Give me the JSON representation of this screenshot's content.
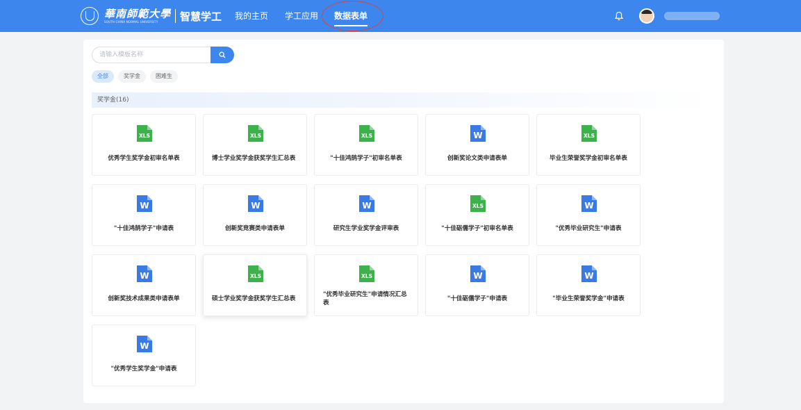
{
  "header": {
    "university_name": "華南師範大學",
    "university_name_en": "SOUTH CHINA NORMAL UNIVERSITY",
    "brand": "智慧学工",
    "nav": [
      {
        "label": "我的主页",
        "active": false
      },
      {
        "label": "学工应用",
        "active": false
      },
      {
        "label": "数据表单",
        "active": true
      }
    ],
    "colors": {
      "bar": "#3d86ee",
      "annotation": "#e04040"
    }
  },
  "search": {
    "placeholder": "请输入模板名称",
    "value": ""
  },
  "filters": [
    {
      "label": "全部",
      "active": true
    },
    {
      "label": "奖学金",
      "active": false
    },
    {
      "label": "困难生",
      "active": false
    }
  ],
  "section": {
    "title": "奖学金(16)"
  },
  "templates": [
    {
      "type": "XLS",
      "title": "优秀学生奖学金初审名单表"
    },
    {
      "type": "XLS",
      "title": "博士学业奖学金获奖学生汇总表"
    },
    {
      "type": "XLS",
      "title": "\"十佳鸿鹄学子\"初审名单表"
    },
    {
      "type": "W",
      "title": "创新奖论文类申请表单"
    },
    {
      "type": "XLS",
      "title": "毕业生荣誉奖学金初审名单表"
    },
    {
      "type": "W",
      "title": "\"十佳鸿鹄学子\"申请表"
    },
    {
      "type": "W",
      "title": "创新奖竞赛类申请表单"
    },
    {
      "type": "W",
      "title": "研究生学业奖学金评审表"
    },
    {
      "type": "XLS",
      "title": "\"十佳砺儒学子\"初审名单表"
    },
    {
      "type": "W",
      "title": "\"优秀毕业研究生\"申请表"
    },
    {
      "type": "W",
      "title": "创新奖技术成果类申请表单"
    },
    {
      "type": "XLS",
      "title": "硕士学业奖学金获奖学生汇总表"
    },
    {
      "type": "XLS",
      "title": "\"优秀毕业研究生\"申请情况汇总表"
    },
    {
      "type": "W",
      "title": "\"十佳砺儒学子\"申请表"
    },
    {
      "type": "W",
      "title": "\"毕业生荣誉奖学金\"申请表"
    },
    {
      "type": "W",
      "title": "\"优秀学生奖学金\"申请表"
    }
  ],
  "file_colors": {
    "XLS": "#3db24b",
    "W": "#3a7ae4"
  },
  "icons": [
    "university-seal-icon",
    "search-icon",
    "bell-icon",
    "avatar",
    "xls-file-icon",
    "word-file-icon"
  ]
}
